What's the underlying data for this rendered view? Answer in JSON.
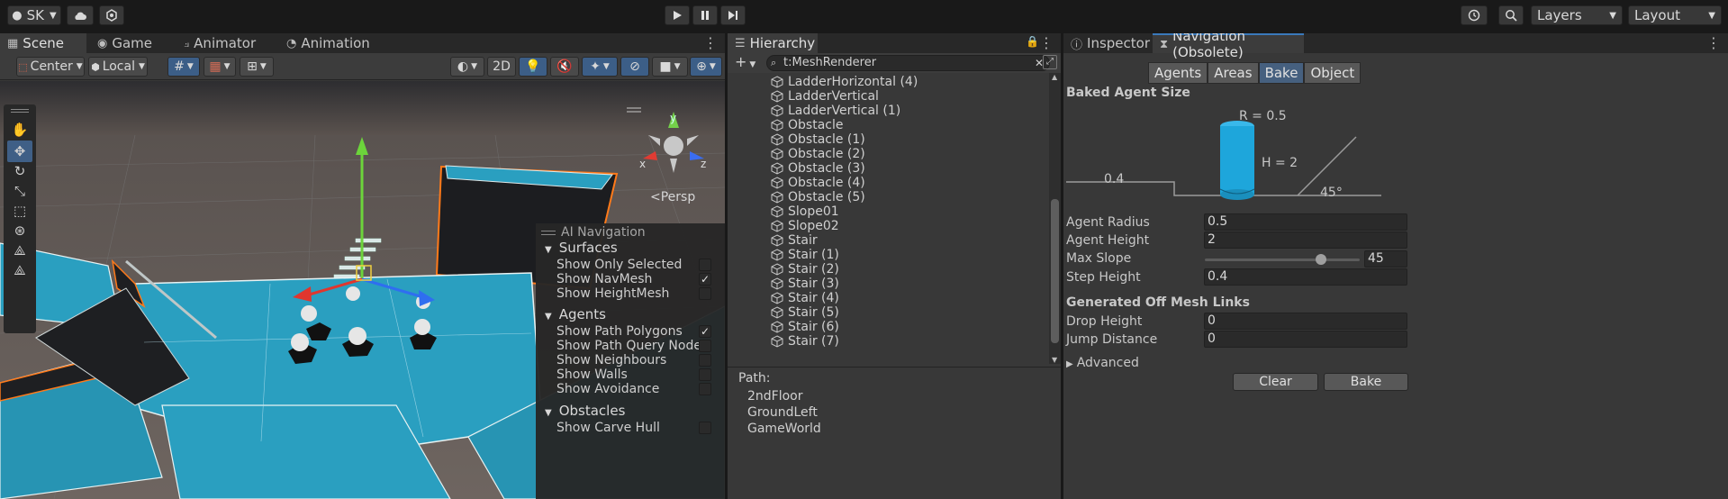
{
  "toolbar": {
    "account_label": "SK",
    "play_icon": "play-icon",
    "pause_icon": "pause-icon",
    "step_icon": "step-icon",
    "layers_label": "Layers",
    "layout_label": "Layout"
  },
  "scene_panel": {
    "tabs": [
      {
        "label": "Scene",
        "icon": "scene-grid-icon"
      },
      {
        "label": "Game",
        "icon": "gamepad-icon"
      },
      {
        "label": "Animator",
        "icon": "animator-icon"
      },
      {
        "label": "Animation",
        "icon": "animation-clock-icon"
      }
    ],
    "pivot_mode": "Center",
    "pivot_rotation": "Local",
    "two_d_label": "2D",
    "persp_label": "Persp",
    "ai_navigation": {
      "title": "AI Navigation",
      "sections": [
        {
          "name": "Surfaces",
          "options": [
            {
              "label": "Show Only Selected",
              "checked": false
            },
            {
              "label": "Show NavMesh",
              "checked": true
            },
            {
              "label": "Show HeightMesh",
              "checked": false
            }
          ]
        },
        {
          "name": "Agents",
          "options": [
            {
              "label": "Show Path Polygons",
              "checked": true
            },
            {
              "label": "Show Path Query Nodes",
              "checked": false
            },
            {
              "label": "Show Neighbours",
              "checked": false
            },
            {
              "label": "Show Walls",
              "checked": false
            },
            {
              "label": "Show Avoidance",
              "checked": false
            }
          ]
        },
        {
          "name": "Obstacles",
          "options": [
            {
              "label": "Show Carve Hull",
              "checked": false
            }
          ]
        }
      ]
    },
    "colors": {
      "navmesh": "#2a9fc0",
      "selection_outline": "#ff7a1a"
    }
  },
  "hierarchy": {
    "title": "Hierarchy",
    "search_value": "t:MeshRenderer",
    "items": [
      "LadderHorizontal (4)",
      "LadderVertical",
      "LadderVertical (1)",
      "Obstacle",
      "Obstacle (1)",
      "Obstacle (2)",
      "Obstacle (3)",
      "Obstacle (4)",
      "Obstacle (5)",
      "Slope01",
      "Slope02",
      "Stair",
      "Stair (1)",
      "Stair (2)",
      "Stair (3)",
      "Stair (4)",
      "Stair (5)",
      "Stair (6)",
      "Stair (7)"
    ],
    "path_label": "Path:",
    "path": [
      "2ndFloor",
      "GroundLeft",
      "GameWorld"
    ]
  },
  "inspector": {
    "tabs": [
      {
        "label": "Inspector",
        "icon": "info-icon"
      },
      {
        "label": "Navigation (Obsolete)",
        "icon": "navigation-icon"
      }
    ],
    "nav_tabs": [
      "Agents",
      "Areas",
      "Bake",
      "Object"
    ],
    "nav_tab_selected": "Bake",
    "baked_agent_size": {
      "title": "Baked Agent Size",
      "radius_text": "R = 0.5",
      "height_text": "H = 2",
      "step_text": "0.4",
      "slope_text": "45°"
    },
    "fields": {
      "agent_radius": {
        "label": "Agent Radius",
        "value": "0.5"
      },
      "agent_height": {
        "label": "Agent Height",
        "value": "2"
      },
      "max_slope": {
        "label": "Max Slope",
        "value": "45",
        "slider_fraction": 0.75
      },
      "step_height": {
        "label": "Step Height",
        "value": "0.4"
      }
    },
    "off_mesh": {
      "title": "Generated Off Mesh Links",
      "drop_height": {
        "label": "Drop Height",
        "value": "0"
      },
      "jump_distance": {
        "label": "Jump Distance",
        "value": "0"
      }
    },
    "advanced_label": "Advanced",
    "clear_label": "Clear",
    "bake_label": "Bake",
    "colors": {
      "agent_cylinder": "#1ea6db",
      "selected_tab": "#46607f"
    }
  }
}
